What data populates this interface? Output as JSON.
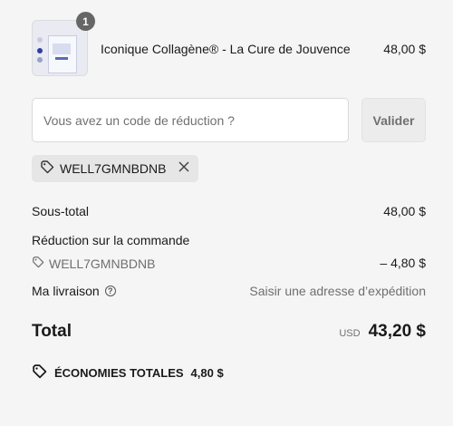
{
  "line_item": {
    "quantity": "1",
    "name": "Iconique Collagène® - La Cure de Jouvence",
    "price": "48,00 $"
  },
  "discount": {
    "placeholder": "Vous avez un code de réduction ?",
    "apply_label": "Valider",
    "applied_code": "WELL7GMNBDNB"
  },
  "summary": {
    "subtotal_label": "Sous-total",
    "subtotal_value": "48,00 $",
    "order_discount_label": "Réduction sur la commande",
    "order_discount_code": "WELL7GMNBDNB",
    "order_discount_value": "– 4,80 $",
    "shipping_label": "Ma livraison",
    "shipping_value": "Saisir une adresse d’expédition"
  },
  "total": {
    "label": "Total",
    "currency": "USD",
    "value": "43,20 $"
  },
  "savings": {
    "label": "ÉCONOMIES TOTALES",
    "value": "4,80 $"
  },
  "colors": {
    "background": "#f5f5f5",
    "chip": "#e6e6e6",
    "muted_text": "#6f6f6f"
  }
}
